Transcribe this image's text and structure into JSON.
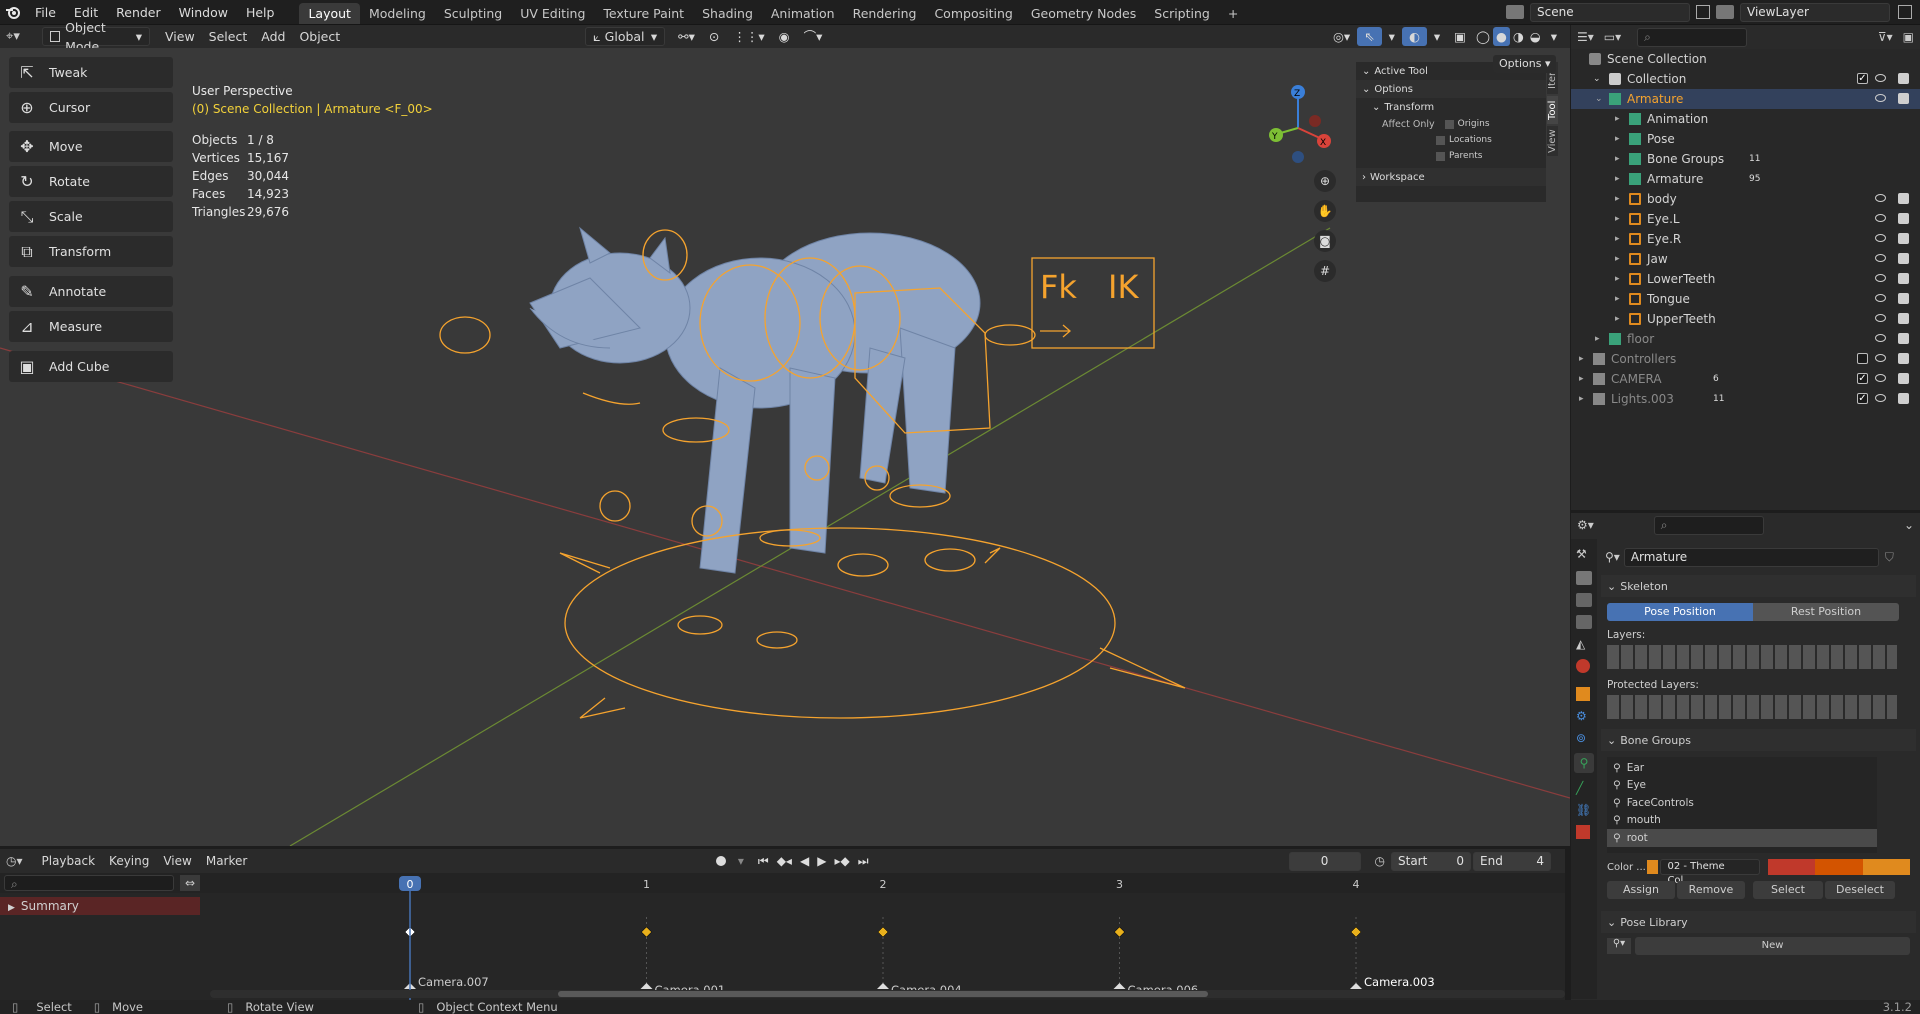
{
  "topbar": {
    "menus": [
      "File",
      "Edit",
      "Render",
      "Window",
      "Help"
    ],
    "workspaces": [
      "Layout",
      "Modeling",
      "Sculpting",
      "UV Editing",
      "Texture Paint",
      "Shading",
      "Animation",
      "Rendering",
      "Compositing",
      "Geometry Nodes",
      "Scripting"
    ],
    "active_workspace": "Layout",
    "add_tab": "+",
    "scene": "Scene",
    "view_layer": "ViewLayer"
  },
  "viewport_header": {
    "mode": "Object Mode",
    "menus": [
      "View",
      "Select",
      "Add",
      "Object"
    ],
    "orientation": "Global",
    "options": "Options"
  },
  "viewport": {
    "perspective": "User Perspective",
    "collection_path": "(0) Scene Collection | Armature <F_00>",
    "stats": [
      {
        "label": "Objects",
        "value": "1 / 8"
      },
      {
        "label": "Vertices",
        "value": "15,167"
      },
      {
        "label": "Edges",
        "value": "30,044"
      },
      {
        "label": "Faces",
        "value": "14,923"
      },
      {
        "label": "Triangles",
        "value": "29,676"
      }
    ],
    "fk_label": "Fk",
    "ik_label": "IK",
    "gizmo": {
      "x": "X",
      "y": "Y",
      "z": "Z"
    }
  },
  "toolbar": {
    "tools": [
      "Tweak",
      "Cursor",
      "Move",
      "Rotate",
      "Scale",
      "Transform",
      "Annotate",
      "Measure",
      "Add Cube"
    ]
  },
  "npanel": {
    "active_tool": "Active Tool",
    "options": "Options",
    "transform": "Transform",
    "affect_only": "Affect Only",
    "origins": "Origins",
    "locations": "Locations",
    "parents": "Parents",
    "workspace": "Workspace",
    "tabs": [
      "Item",
      "Tool",
      "View"
    ]
  },
  "outliner": {
    "root": "Scene Collection",
    "collection": "Collection",
    "items": [
      {
        "name": "Armature",
        "level": 2,
        "selected": true
      },
      {
        "name": "Animation",
        "level": 3
      },
      {
        "name": "Pose",
        "level": 3
      },
      {
        "name": "Bone Groups",
        "level": 3,
        "badge": "11"
      },
      {
        "name": "Armature",
        "level": 3,
        "badge": "95"
      },
      {
        "name": "body",
        "level": 3
      },
      {
        "name": "Eye.L",
        "level": 3
      },
      {
        "name": "Eye.R",
        "level": 3
      },
      {
        "name": "Jaw",
        "level": 3
      },
      {
        "name": "LowerTeeth",
        "level": 3
      },
      {
        "name": "Tongue",
        "level": 3
      },
      {
        "name": "UpperTeeth",
        "level": 3
      },
      {
        "name": "floor",
        "level": 2,
        "dim": true
      },
      {
        "name": "Controllers",
        "level": 1,
        "dim": true
      },
      {
        "name": "CAMERA",
        "level": 1,
        "dim": true,
        "badge": "6"
      },
      {
        "name": "Lights.003",
        "level": 1,
        "dim": true,
        "badge": "11"
      }
    ]
  },
  "properties": {
    "object_name": "Armature",
    "skeleton": "Skeleton",
    "pose_position": "Pose Position",
    "rest_position": "Rest Position",
    "layers": "Layers:",
    "protected_layers": "Protected Layers:",
    "bone_groups_title": "Bone Groups",
    "bone_groups": [
      "Ear",
      "Eye",
      "FaceControls",
      "mouth",
      "root"
    ],
    "color_label": "Color ...",
    "color_set": "02 - Theme Col...",
    "assign": "Assign",
    "remove": "Remove",
    "select": "Select",
    "deselect": "Deselect",
    "pose_library": "Pose Library",
    "new": "New",
    "colors": {
      "theme1": "#c0392b",
      "theme2": "#d35400",
      "theme3": "#e08a1e"
    }
  },
  "timeline": {
    "menus": [
      "Playback",
      "Keying",
      "View",
      "Marker"
    ],
    "current_frame": "0",
    "start_label": "Start",
    "start": "0",
    "end_label": "End",
    "end": "4",
    "frames": [
      "0",
      "1",
      "2",
      "3",
      "4"
    ],
    "summary": "Summary",
    "markers": [
      "Camera.007",
      "Camera.001",
      "Camera.004",
      "Camera.006",
      "Camera.003"
    ]
  },
  "statusbar": {
    "select": "Select",
    "move": "Move",
    "rotate_view": "Rotate View",
    "context_menu": "Object Context Menu",
    "version": "3.1.2"
  },
  "colors": {
    "accent": "#4772b3",
    "selection": "#f5a32e",
    "keyframe": "#e8b01c"
  }
}
